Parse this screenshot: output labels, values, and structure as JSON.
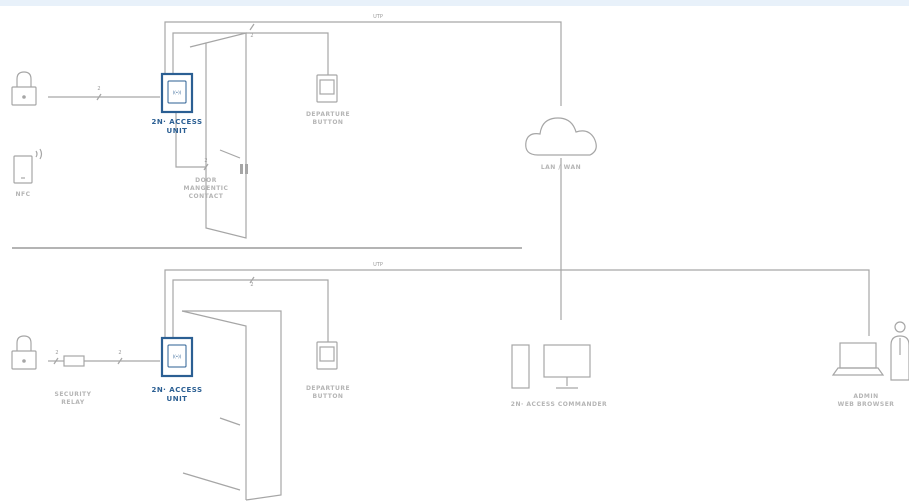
{
  "colors": {
    "line": "#a6a6a6",
    "blue": "#2b5f93",
    "text_gray": "#b5b5b5",
    "bg_bar": "#e8f1fa"
  },
  "top": {
    "utp": "UTP",
    "cable_count": "2",
    "access_unit": "2N· ACCESS\nUNIT",
    "departure_button": "DEPARTURE\nBUTTON",
    "door_contact": "DOOR\nMANGENTIC\nCONTACT",
    "nfc": "NFC",
    "lan_wan": "LAN / WAN"
  },
  "bottom": {
    "utp": "UTP",
    "cable_count": "2",
    "security_relay": "SECURITY\nRELAY",
    "access_unit": "2N· ACCESS\nUNIT",
    "departure_button": "DEPARTURE\nBUTTON",
    "access_commander": "2N· ACCESS COMMANDER",
    "admin_browser": "ADMIN\nWEB BROWSER"
  }
}
